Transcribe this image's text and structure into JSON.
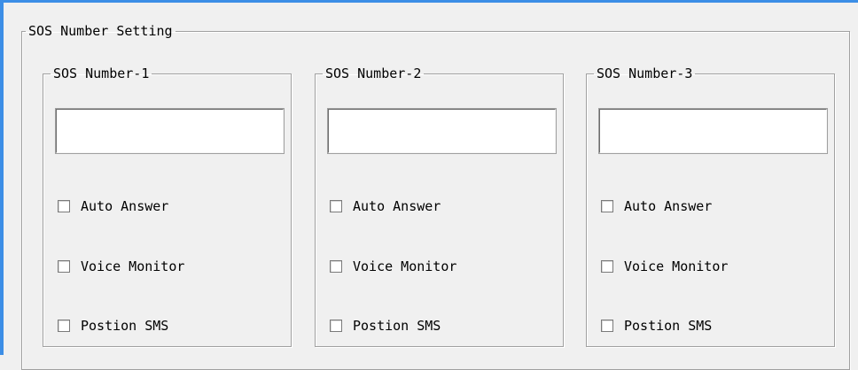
{
  "window": {
    "group_title": "SOS Number Setting"
  },
  "sos_numbers": [
    {
      "title": "SOS Number-1",
      "value": "",
      "options": [
        {
          "label": "Auto Answer",
          "checked": false
        },
        {
          "label": "Voice Monitor",
          "checked": false
        },
        {
          "label": "Postion SMS",
          "checked": false
        }
      ]
    },
    {
      "title": "SOS Number-2",
      "value": "",
      "options": [
        {
          "label": "Auto Answer",
          "checked": false
        },
        {
          "label": "Voice Monitor",
          "checked": false
        },
        {
          "label": "Postion SMS",
          "checked": false
        }
      ]
    },
    {
      "title": "SOS Number-3",
      "value": "",
      "options": [
        {
          "label": "Auto Answer",
          "checked": false
        },
        {
          "label": "Voice Monitor",
          "checked": false
        },
        {
          "label": "Postion SMS",
          "checked": false
        }
      ]
    }
  ],
  "colors": {
    "window_border": "#3c8ee6",
    "background": "#f0f0f0",
    "group_border": "#a0a0a0"
  }
}
